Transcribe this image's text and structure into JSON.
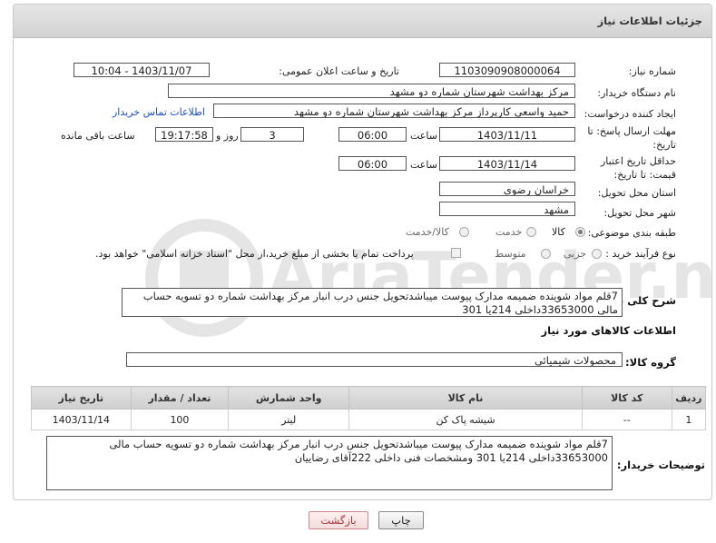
{
  "header": {
    "title": "جزئیات اطلاعات نیاز"
  },
  "fields": {
    "need_number_label": "شماره نیاز:",
    "need_number": "1103090908000064",
    "announce_label": "تاریخ و ساعت اعلان عمومی:",
    "announce_value": "1403/11/07 - 10:04",
    "buyer_org_label": "نام دستگاه خریدار:",
    "buyer_org": "مرکز بهداشت شهرستان شماره دو مشهد",
    "requester_label": "ایجاد کننده درخواست:",
    "requester": "حمید واسعی کارپرداز مرکز بهداشت شهرستان شماره دو مشهد",
    "contact_link": "اطلاعات تماس خریدار",
    "reply_deadline_label": "مهلت ارسال پاسخ: تا تاریخ:",
    "reply_date": "1403/11/11",
    "time_label": "ساعت",
    "reply_time": "06:00",
    "days_value": "3",
    "days_label": "روز و",
    "remaining_time": "19:17:58",
    "remaining_label": "ساعت باقی مانده",
    "price_validity_label": "حداقل تاریخ اعتبار قیمت: تا تاریخ:",
    "price_date": "1403/11/14",
    "price_time": "06:00",
    "province_label": "استان محل تحویل:",
    "province": "خراسان رضوی",
    "city_label": "شهر محل تحویل:",
    "city": "مشهد",
    "category_label": "طبقه بندی موضوعی:",
    "category_options": [
      "کالا",
      "خدمت",
      "کالا/خدمت"
    ],
    "process_label": "نوع فرآیند خرید :",
    "process_options": [
      "جزیی",
      "متوسط"
    ],
    "payment_note": "پرداخت تمام یا بخشی از مبلغ خرید،از محل \"اسناد خزانه اسلامی\" خواهد بود.",
    "description_label": "شرح کلی نیاز:",
    "description": "7قلم مواد شوینده ضمیمه مدارک پیوست میباشدتحویل جنس درب انبار مرکز بهداشت شماره دو تسویه حساب مالی 33653000داخلی 214یا 301"
  },
  "goods": {
    "section_title": "اطلاعات کالاهای مورد نیاز",
    "group_label": "گروه کالا:",
    "group_value": "محصولات شیمیائی",
    "columns": [
      "ردیف",
      "کد کالا",
      "نام کالا",
      "واحد شمارش",
      "تعداد / مقدار",
      "تاریخ نیاز"
    ],
    "rows": [
      [
        "1",
        "--",
        "شیشه پاک کن",
        "لیتر",
        "100",
        "1403/11/14"
      ]
    ]
  },
  "buyer_notes": {
    "label": "توضیحات خریدار:",
    "text": "7قلم مواد شوینده ضمیمه مدارک پیوست میباشدتحویل جنس درب انبار مرکز بهداشت شماره دو تسویه حساب مالی 33653000داخلی 214یا 301 ومشخصات فنی داخلی 222آقای رضاییان"
  },
  "buttons": {
    "print": "چاپ",
    "back": "بازگشت"
  },
  "watermark": {
    "text": "AriaTender.neT"
  },
  "colors": {
    "link": "#1a4fc4",
    "header_bg": "#d8d8d8",
    "back_text": "#a33333"
  }
}
